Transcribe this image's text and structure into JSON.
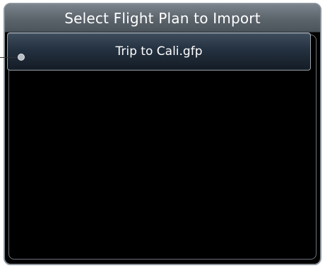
{
  "dialog": {
    "title": "Select Flight Plan to Import",
    "items": [
      {
        "label": "Trip to Cali.gfp"
      }
    ]
  }
}
